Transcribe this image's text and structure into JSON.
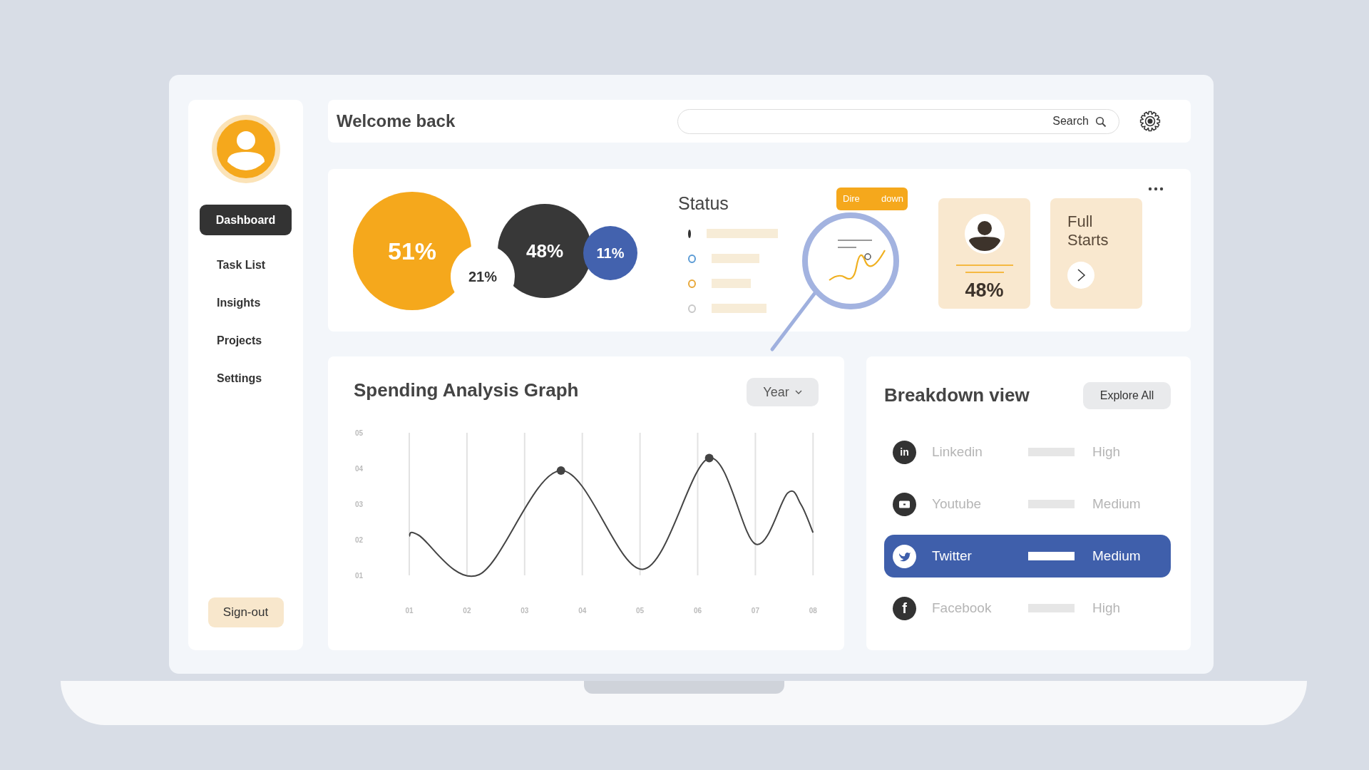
{
  "header": {
    "title": "Welcome back",
    "search": {
      "placeholder": "Search"
    }
  },
  "sidebar": {
    "items": [
      {
        "label": "Dashboard",
        "selected": true
      },
      {
        "label": "Task List",
        "selected": false
      },
      {
        "label": "Insights",
        "selected": false
      },
      {
        "label": "Projects",
        "selected": false
      },
      {
        "label": "Settings",
        "selected": false
      }
    ],
    "signout": "Sign-out"
  },
  "overview": {
    "bubbles": [
      {
        "label": "51%",
        "color": "#f5a81c"
      },
      {
        "label": "48%",
        "color": "#383838"
      },
      {
        "label": "11%",
        "color": "#4362ae"
      },
      {
        "label": "21%",
        "color": "#ffffff"
      }
    ],
    "status": {
      "title": "Status",
      "items": [
        {
          "color": "#333333"
        },
        {
          "color": "#5b9bd5"
        },
        {
          "color": "#e8a83a"
        },
        {
          "color": "#c8c8c8"
        }
      ]
    },
    "badge_parts": [
      "Dire",
      "down"
    ],
    "person_card": {
      "value": "48%"
    },
    "link_card": {
      "label": "Full Starts"
    }
  },
  "spending": {
    "title": "Spending Analysis Graph",
    "period": "Year",
    "chart_data": {
      "type": "line",
      "x": [
        1,
        1.16,
        2.21,
        3.63,
        5.05,
        6.2,
        7.0,
        7.56,
        7.79,
        8
      ],
      "xlim": [
        1,
        8
      ],
      "ylim": [
        1,
        5
      ],
      "grid": true,
      "series": [
        {
          "color": "#444444",
          "values": [
            2.1,
            2.13,
            1.02,
            3.94,
            1.17,
            4.29,
            1.88,
            3.31,
            2.99,
            2.2
          ]
        }
      ],
      "xticks": [
        {
          "value": 1,
          "label": "01"
        },
        {
          "value": 2,
          "label": "02"
        },
        {
          "value": 3,
          "label": "03"
        },
        {
          "value": 4,
          "label": "04"
        },
        {
          "value": 5,
          "label": "05"
        },
        {
          "value": 6,
          "label": "06"
        },
        {
          "value": 7,
          "label": "07"
        },
        {
          "value": 8,
          "label": "08"
        }
      ],
      "yticks": [
        {
          "value": 5,
          "label": "05"
        },
        {
          "value": 4,
          "label": "04"
        },
        {
          "value": 3,
          "label": "03"
        },
        {
          "value": 2,
          "label": "02"
        },
        {
          "value": 1,
          "label": "01"
        }
      ]
    }
  },
  "breakdown": {
    "title": "Breakdown view",
    "button": "Explore All",
    "rows": [
      {
        "kind": "letters",
        "icon_text": "in",
        "name": "Linkedin",
        "level_text": "High",
        "selected": false
      },
      {
        "kind": "screen",
        "name": "Youtube",
        "level_text": "Medium",
        "selected": false
      },
      {
        "kind": "bird",
        "name": "Twitter",
        "level_text": "Medium",
        "selected": true
      },
      {
        "kind": "letters",
        "icon_text": "f",
        "name": "Facebook",
        "level_text": "High",
        "selected": false
      }
    ]
  }
}
